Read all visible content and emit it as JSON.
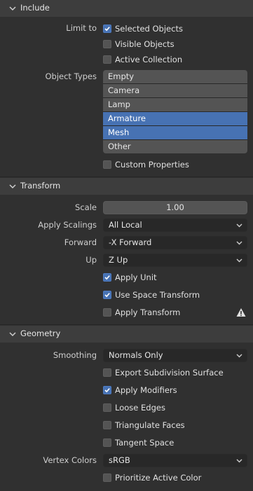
{
  "include": {
    "title": "Include",
    "limit_to_label": "Limit to",
    "limit_options": [
      {
        "label": "Selected Objects",
        "checked": true
      },
      {
        "label": "Visible Objects",
        "checked": false
      },
      {
        "label": "Active Collection",
        "checked": false
      }
    ],
    "object_types_label": "Object Types",
    "object_types": [
      {
        "label": "Empty",
        "selected": false
      },
      {
        "label": "Camera",
        "selected": false
      },
      {
        "label": "Lamp",
        "selected": false
      },
      {
        "label": "Armature",
        "selected": true
      },
      {
        "label": "Mesh",
        "selected": true
      },
      {
        "label": "Other",
        "selected": false
      }
    ],
    "custom_properties": {
      "label": "Custom Properties",
      "checked": false
    }
  },
  "transform": {
    "title": "Transform",
    "scale_label": "Scale",
    "scale_value": "1.00",
    "apply_scalings_label": "Apply Scalings",
    "apply_scalings_value": "All Local",
    "forward_label": "Forward",
    "forward_value": "-X Forward",
    "up_label": "Up",
    "up_value": "Z Up",
    "apply_unit": {
      "label": "Apply Unit",
      "checked": true
    },
    "use_space_transform": {
      "label": "Use Space Transform",
      "checked": true
    },
    "apply_transform": {
      "label": "Apply Transform",
      "checked": false
    }
  },
  "geometry": {
    "title": "Geometry",
    "smoothing_label": "Smoothing",
    "smoothing_value": "Normals Only",
    "export_subdivision": {
      "label": "Export Subdivision Surface",
      "checked": false
    },
    "apply_modifiers": {
      "label": "Apply Modifiers",
      "checked": true
    },
    "loose_edges": {
      "label": "Loose Edges",
      "checked": false
    },
    "triangulate_faces": {
      "label": "Triangulate Faces",
      "checked": false
    },
    "tangent_space": {
      "label": "Tangent Space",
      "checked": false
    },
    "vertex_colors_label": "Vertex Colors",
    "vertex_colors_value": "sRGB",
    "prioritize_active_color": {
      "label": "Prioritize Active Color",
      "checked": false
    }
  },
  "colors": {
    "accent": "#4772b3",
    "panel_bg": "#303030",
    "header_bg": "#3d3d3d"
  }
}
